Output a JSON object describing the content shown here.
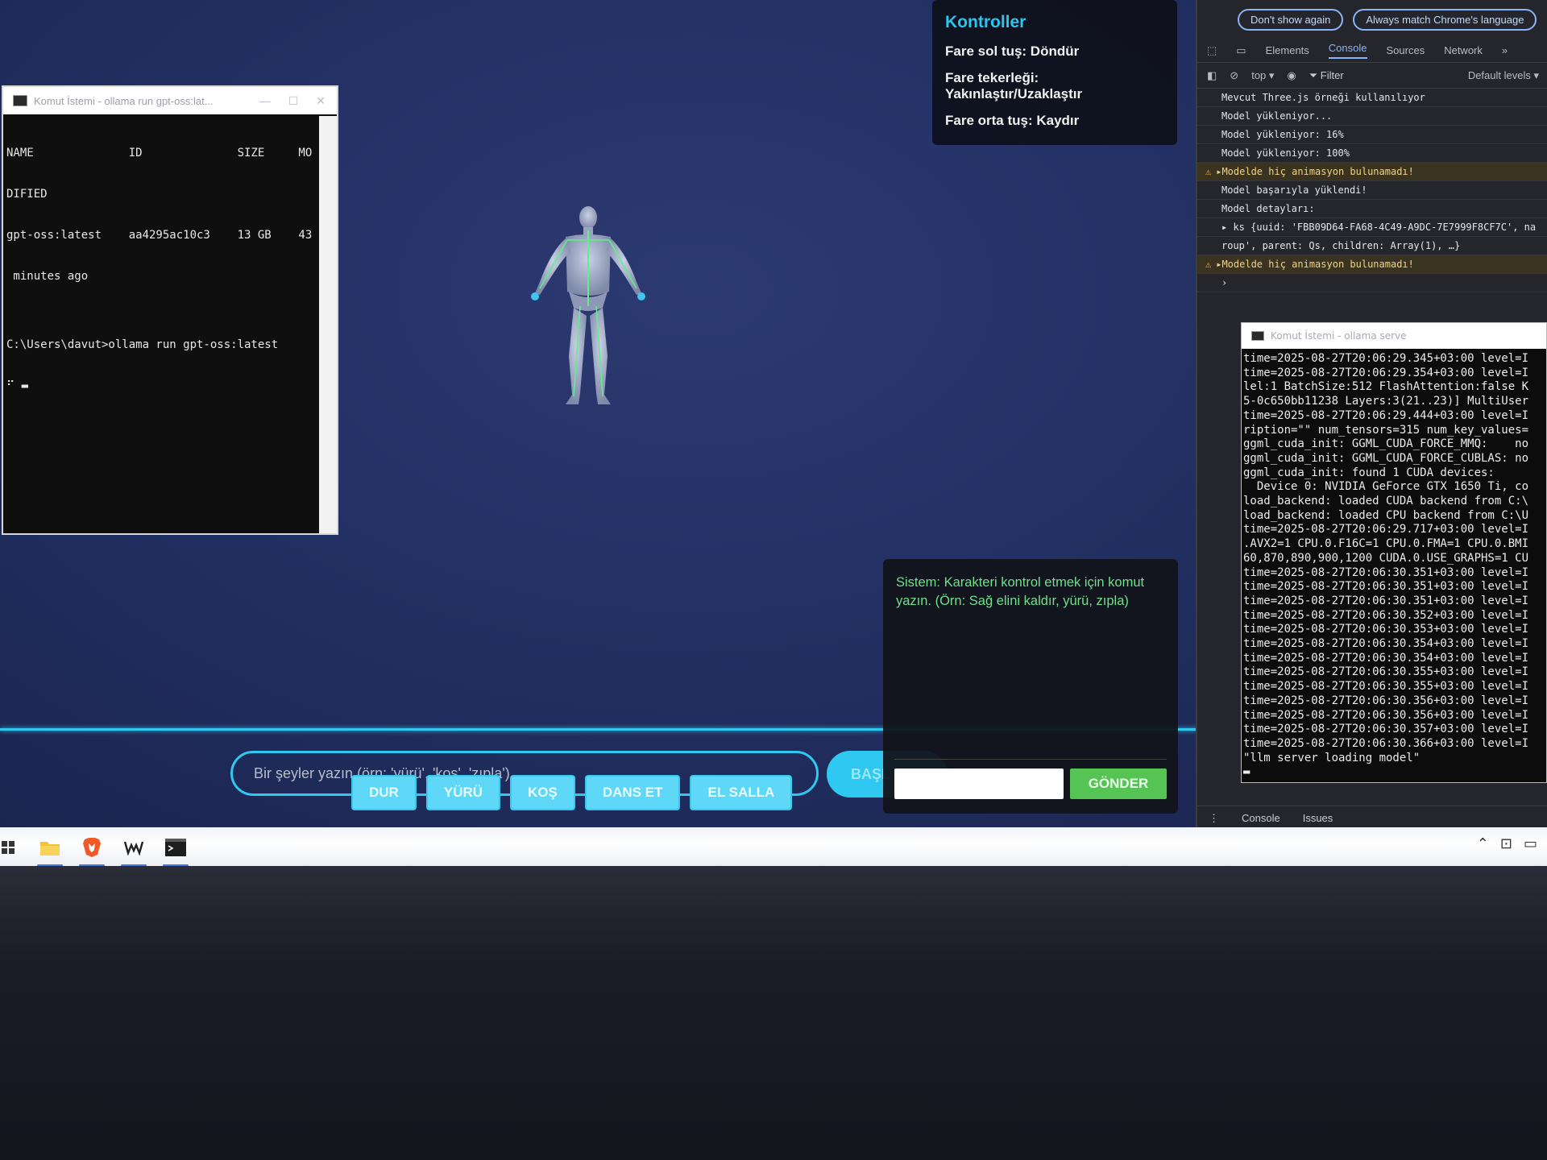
{
  "controls": {
    "title": "Kontroller",
    "lines": [
      "Fare sol tuş: Döndür",
      "Fare tekerleği: Yakınlaştır/Uzaklaştır",
      "Fare orta tuş: Kaydır"
    ]
  },
  "terminal1": {
    "title": "Komut İstemi - ollama  run gpt-oss:lat...",
    "lines": [
      "NAME              ID              SIZE     MO",
      "DIFIED",
      "gpt-oss:latest    aa4295ac10c3    13 GB    43",
      " minutes ago",
      "",
      "C:\\Users\\davut>ollama run gpt-oss:latest",
      "⠋ ▬"
    ]
  },
  "bottom": {
    "input_placeholder": "Bir şeyler yazın (örn: 'yürü', 'koş', 'zıpla')",
    "start_label": "BAŞL",
    "actions": [
      "DUR",
      "YÜRÜ",
      "KOŞ",
      "DANS ET",
      "EL SALLA"
    ]
  },
  "chat": {
    "system_message": "Sistem: Karakteri kontrol etmek için komut yazın. (Örn: Sağ elini kaldır, yürü, zıpla)",
    "send_label": "GÖNDER"
  },
  "devtools": {
    "banner_buttons": [
      "Don't show again",
      "Always match Chrome's language"
    ],
    "tabs": [
      "Elements",
      "Console",
      "Sources",
      "Network",
      "»"
    ],
    "toolbar": {
      "context": "top ▾",
      "filter": "Filter",
      "levels": "Default levels ▾"
    },
    "console": [
      {
        "type": "log",
        "text": "Mevcut Three.js örneği kullanılıyor"
      },
      {
        "type": "log",
        "text": "Model yükleniyor..."
      },
      {
        "type": "log",
        "text": "Model yükleniyor: 16%"
      },
      {
        "type": "log",
        "text": "Model yükleniyor: 100%"
      },
      {
        "type": "warn",
        "text": "▸Modelde hiç animasyon bulunamadı!"
      },
      {
        "type": "log",
        "text": "Model başarıyla yüklendi!"
      },
      {
        "type": "log",
        "text": "Model detayları:"
      },
      {
        "type": "obj",
        "text": "▸ ks {uuid: 'FBB09D64-FA68-4C49-A9DC-7E7999F8CF7C', na"
      },
      {
        "type": "obj",
        "text": "roup', parent: Qs, children: Array(1), …}"
      },
      {
        "type": "warn",
        "text": "▸Modelde hiç animasyon bulunamadı!"
      },
      {
        "type": "prompt",
        "text": "›"
      }
    ],
    "bottom_tabs": [
      "Console",
      "Issues"
    ]
  },
  "terminal2": {
    "title": "Komut İstemi - ollama  serve",
    "lines": [
      "time=2025-08-27T20:06:29.345+03:00 level=I",
      "time=2025-08-27T20:06:29.354+03:00 level=I",
      "lel:1 BatchSize:512 FlashAttention:false K",
      "5-0c650bb11238 Layers:3(21..23)] MultiUser",
      "time=2025-08-27T20:06:29.444+03:00 level=I",
      "ription=\"\" num_tensors=315 num_key_values=",
      "ggml_cuda_init: GGML_CUDA_FORCE_MMQ:    no",
      "ggml_cuda_init: GGML_CUDA_FORCE_CUBLAS: no",
      "ggml_cuda_init: found 1 CUDA devices:",
      "  Device 0: NVIDIA GeForce GTX 1650 Ti, co",
      "load_backend: loaded CUDA backend from C:\\",
      "load_backend: loaded CPU backend from C:\\U",
      "time=2025-08-27T20:06:29.717+03:00 level=I",
      ".AVX2=1 CPU.0.F16C=1 CPU.0.FMA=1 CPU.0.BMI",
      "60,870,890,900,1200 CUDA.0.USE_GRAPHS=1 CU",
      "time=2025-08-27T20:06:30.351+03:00 level=I",
      "time=2025-08-27T20:06:30.351+03:00 level=I",
      "time=2025-08-27T20:06:30.351+03:00 level=I",
      "time=2025-08-27T20:06:30.352+03:00 level=I",
      "time=2025-08-27T20:06:30.353+03:00 level=I",
      "time=2025-08-27T20:06:30.354+03:00 level=I",
      "time=2025-08-27T20:06:30.354+03:00 level=I",
      "time=2025-08-27T20:06:30.355+03:00 level=I",
      "time=2025-08-27T20:06:30.355+03:00 level=I",
      "time=2025-08-27T20:06:30.356+03:00 level=I",
      "time=2025-08-27T20:06:30.356+03:00 level=I",
      "time=2025-08-27T20:06:30.357+03:00 level=I",
      "time=2025-08-27T20:06:30.366+03:00 level=I",
      "\"llm server loading model\"",
      "▬"
    ]
  },
  "taskbar": {
    "icons": [
      "windows-start-icon",
      "file-explorer-icon",
      "brave-browser-icon",
      "wps-office-icon",
      "terminal-icon"
    ],
    "tray_icons": [
      "chevron-up-icon",
      "network-icon",
      "battery-icon"
    ]
  }
}
